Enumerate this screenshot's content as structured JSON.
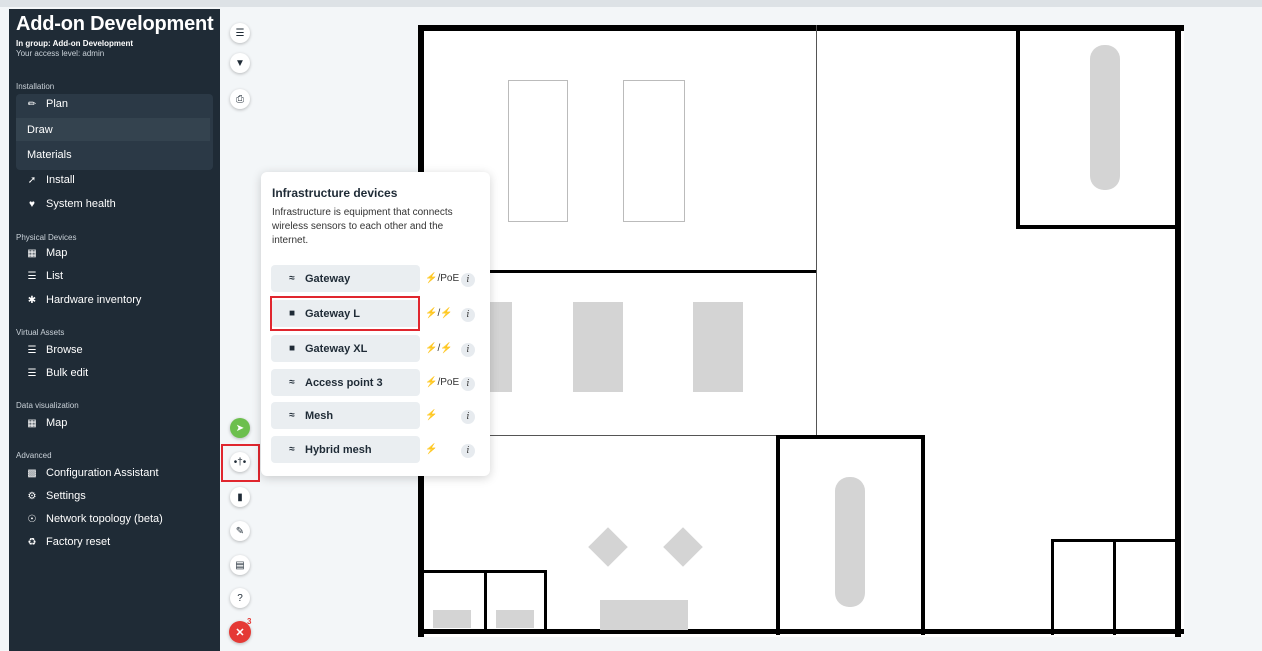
{
  "app": {
    "title": "Add-on Development",
    "group_line": "In group: Add-on Development",
    "access_line": "Your access level: admin"
  },
  "sidebar": {
    "installation_label": "Installation",
    "plan": "Plan",
    "draw": "Draw",
    "materials": "Materials",
    "install": "Install",
    "system_health": "System health",
    "physical_label": "Physical Devices",
    "physical_map": "Map",
    "list": "List",
    "hardware_inventory": "Hardware inventory",
    "virtual_label": "Virtual Assets",
    "browse": "Browse",
    "bulk_edit": "Bulk edit",
    "dataviz_label": "Data visualization",
    "dataviz_map": "Map",
    "advanced_label": "Advanced",
    "config_assistant": "Configuration Assistant",
    "settings": "Settings",
    "network_topology": "Network topology (beta)",
    "factory_reset": "Factory reset"
  },
  "toolbar": {
    "notification_count": "3"
  },
  "popup": {
    "title": "Infrastructure devices",
    "description": "Infrastructure is equipment that connects wireless sensors to each other and the internet.",
    "devices": [
      {
        "label": "Gateway",
        "icon": "wifi-icon",
        "power": "/PoE"
      },
      {
        "label": "Gateway L",
        "icon": "square-icon",
        "power": ""
      },
      {
        "label": "Gateway XL",
        "icon": "square-icon",
        "power": ""
      },
      {
        "label": "Access point 3",
        "icon": "wifi-icon",
        "power": "/PoE"
      },
      {
        "label": "Mesh",
        "icon": "wifi-icon",
        "power": ""
      },
      {
        "label": "Hybrid mesh",
        "icon": "wifi-icon",
        "power": ""
      }
    ],
    "info_label": "i"
  },
  "colors": {
    "sidebar_bg": "#1f2b36",
    "highlight": "#e0262e",
    "cursor_button": "#6cbf4d",
    "close_button": "#e53935"
  }
}
